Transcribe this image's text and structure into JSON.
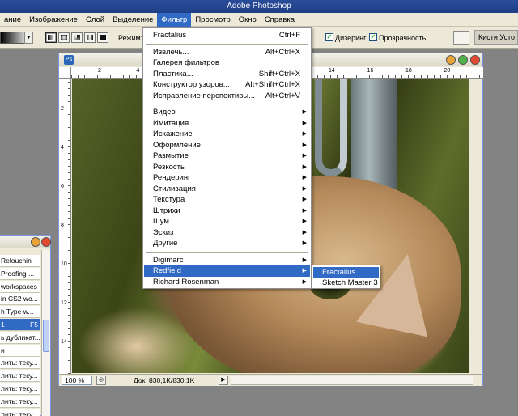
{
  "app": {
    "title": "Adobe Photoshop"
  },
  "menubar": {
    "items": [
      {
        "label": "ание"
      },
      {
        "label": "Изображение"
      },
      {
        "label": "Слой"
      },
      {
        "label": "Выделение"
      },
      {
        "label": "Фильтр",
        "active": true
      },
      {
        "label": "Просмотр"
      },
      {
        "label": "Окно"
      },
      {
        "label": "Справка"
      }
    ]
  },
  "options": {
    "mode_label": "Режим:",
    "dither_label": "Дизеринг",
    "transparency_label": "Прозрачность",
    "dither_checked": true,
    "transparency_checked": true,
    "well_tabs": "Кисти  Усто"
  },
  "filter_menu": {
    "groups": [
      [
        {
          "label": "Fractalius",
          "shortcut": "Ctrl+F"
        }
      ],
      [
        {
          "label": "Извлечь...",
          "shortcut": "Alt+Ctrl+X"
        },
        {
          "label": "Галерея фильтров",
          "shortcut": ""
        },
        {
          "label": "Пластика...",
          "shortcut": "Shift+Ctrl+X"
        },
        {
          "label": "Конструктор узоров...",
          "shortcut": "Alt+Shift+Ctrl+X"
        },
        {
          "label": "Исправление перспективы...",
          "shortcut": "Alt+Ctrl+V"
        }
      ],
      [
        {
          "label": "Видео",
          "submenu": true
        },
        {
          "label": "Имитация",
          "submenu": true
        },
        {
          "label": "Искажение",
          "submenu": true
        },
        {
          "label": "Оформление",
          "submenu": true
        },
        {
          "label": "Размытие",
          "submenu": true
        },
        {
          "label": "Резкость",
          "submenu": true
        },
        {
          "label": "Рендеринг",
          "submenu": true
        },
        {
          "label": "Стилизация",
          "submenu": true
        },
        {
          "label": "Текстура",
          "submenu": true
        },
        {
          "label": "Штрихи",
          "submenu": true
        },
        {
          "label": "Шум",
          "submenu": true
        },
        {
          "label": "Эскиз",
          "submenu": true
        },
        {
          "label": "Другие",
          "submenu": true
        }
      ],
      [
        {
          "label": "Digimarc",
          "submenu": true
        },
        {
          "label": "Redfield",
          "submenu": true,
          "selected": true
        },
        {
          "label": "Richard Rosenman",
          "submenu": true
        }
      ]
    ]
  },
  "redfield_submenu": {
    "items": [
      {
        "label": "Fractalius",
        "selected": true
      },
      {
        "label": "Sketch Master 3"
      }
    ]
  },
  "document": {
    "ruler_numbers": [
      "2",
      "4",
      "6",
      "8",
      "10",
      "12",
      "14",
      "16",
      "18",
      "20"
    ],
    "zoom": "100 %",
    "doc_info": "Док: 830,1K/830,1K"
  },
  "history_palette": {
    "rows": [
      {
        "label": "Reloucnin"
      },
      {
        "label": "Proofing ..."
      },
      {
        "label": "workspaces"
      },
      {
        "label": "in CS2 wo..."
      },
      {
        "label": "h Type w..."
      },
      {
        "label": "1",
        "key": "F5",
        "selected": true
      },
      {
        "label": "ь дубликат..."
      },
      {
        "label": "и"
      },
      {
        "label": "лить: теку..."
      },
      {
        "label": "лить: теку..."
      },
      {
        "label": "лить: теку..."
      },
      {
        "label": "лить: теку..."
      },
      {
        "label": "лить: теку..."
      }
    ]
  }
}
